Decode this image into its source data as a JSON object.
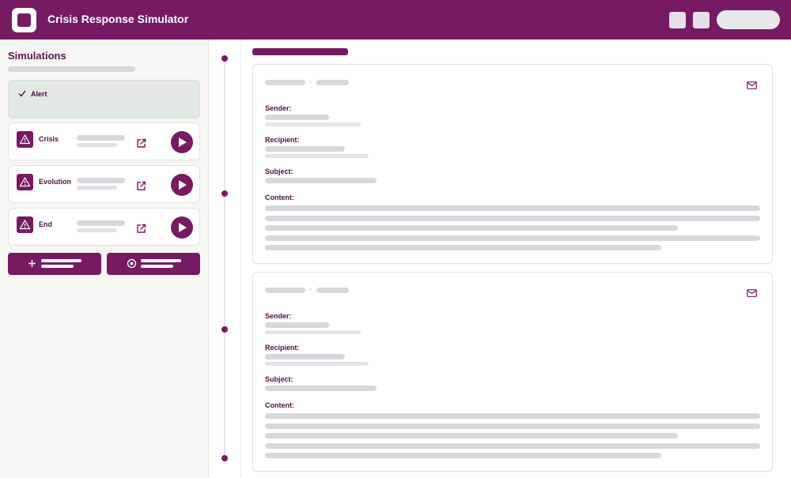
{
  "header": {
    "app_title": "Crisis Response Simulator",
    "brand_color": "#761a63",
    "icons": [
      "logo-icon"
    ]
  },
  "sidebar": {
    "title": "Simulations",
    "alert": {
      "label": "Alert",
      "icon": "check-icon"
    },
    "items": [
      {
        "label": "Crisis",
        "icon": "warning-icon"
      },
      {
        "label": "Evolution",
        "icon": "warning-icon"
      },
      {
        "label": "End",
        "icon": "warning-icon"
      }
    ],
    "actions": [
      {
        "icon": "plus-icon"
      },
      {
        "icon": "target-icon"
      }
    ]
  },
  "main": {
    "messages": [
      {
        "sender_label": "Sender:",
        "recipient_label": "Recipient:",
        "subject_label": "Subject:",
        "content_label": "Content:",
        "icon": "mail-icon"
      },
      {
        "sender_label": "Sender:",
        "recipient_label": "Recipient:",
        "subject_label": "Subject:",
        "content_label": "Content:",
        "icon": "mail-icon"
      }
    ]
  }
}
